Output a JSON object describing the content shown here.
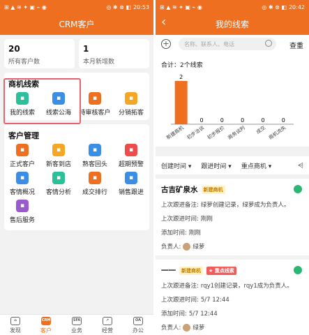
{
  "left": {
    "status": {
      "left": "⊞ ▲ ≋ ✦ ▣ ⌁ ◉",
      "right": "◎ ✱ ⊗ ◧",
      "time": "20:53"
    },
    "title": "CRM客户",
    "stats": [
      {
        "value": "20",
        "caption": "所有客户数"
      },
      {
        "value": "1",
        "caption": "本月新增数"
      }
    ],
    "leads_section": {
      "title": "商机线索",
      "items": [
        {
          "label": "我的线索",
          "icon": "leads-icon",
          "color": "#2bbf9a"
        },
        {
          "label": "线索公海",
          "icon": "pool-icon",
          "color": "#3a8ee6"
        },
        {
          "label": "待审核客户",
          "icon": "review-icon",
          "color": "#ef6f21"
        },
        {
          "label": "分销拓客",
          "icon": "distribution-icon",
          "color": "#f5a623"
        }
      ]
    },
    "customer_section": {
      "title": "客户管理",
      "items": [
        {
          "label": "正式客户",
          "icon": "customer-icon",
          "color": "#ef6f21"
        },
        {
          "label": "新客到店",
          "icon": "store-icon",
          "color": "#f5a623"
        },
        {
          "label": "熟客回头",
          "icon": "chat-icon",
          "color": "#3a8ee6"
        },
        {
          "label": "超期预警",
          "icon": "alarm-icon",
          "color": "#ef4b4b"
        },
        {
          "label": "客情概况",
          "icon": "people-icon",
          "color": "#3a8ee6"
        },
        {
          "label": "客情分析",
          "icon": "analysis-icon",
          "color": "#2bbf9a"
        },
        {
          "label": "成交排行",
          "icon": "rank-icon",
          "color": "#ef6f21"
        },
        {
          "label": "销售跟进",
          "icon": "followup-icon",
          "color": "#3a8ee6"
        },
        {
          "label": "售后服务",
          "icon": "service-icon",
          "color": "#9b59d0"
        }
      ]
    },
    "tabbar": [
      {
        "label": "发现",
        "icon": "discover-icon",
        "glyph": "⌂"
      },
      {
        "label": "客户",
        "icon": "crm-icon",
        "glyph": "CRM",
        "active": true
      },
      {
        "label": "业务",
        "icon": "sfa-icon",
        "glyph": "SFA"
      },
      {
        "label": "经营",
        "icon": "chart-icon",
        "glyph": "↗"
      },
      {
        "label": "办公",
        "icon": "oa-icon",
        "glyph": "OA"
      }
    ]
  },
  "right": {
    "status": {
      "left": "⊞ ▲ ≋ ✦ ▣ ⌁ ◉",
      "right": "◎ ✱ ⊗ ◧",
      "time": "20:42"
    },
    "title": "我的线索",
    "back": "‹",
    "search_placeholder": "名称、联系人、电话",
    "search_button": "查重",
    "summary": "合计：2个线索",
    "chart_data": {
      "type": "bar",
      "categories": [
        "新建商机",
        "初步洽谈",
        "初步报价",
        "商务谈判",
        "成交",
        "商机流失"
      ],
      "values": [
        2,
        0,
        0,
        0,
        0,
        0
      ],
      "color": "#ef6f21"
    },
    "filters": [
      "创建时间",
      "跟进时间",
      "重点商机"
    ],
    "leads": [
      {
        "name": "古吉矿泉水",
        "badges": [
          {
            "text": "新建商机",
            "kind": "new"
          }
        ],
        "rows": [
          {
            "label": "上次跟进备注:",
            "value": "绿萝创建记录，绿萝成为负责人。"
          },
          {
            "label": "上次跟进时间:",
            "value": "刚刚"
          },
          {
            "label": "添加时间:",
            "value": "刚刚"
          },
          {
            "label": "负责人:",
            "value": "绿萝",
            "avatar": true
          }
        ]
      },
      {
        "name": "一一",
        "badges": [
          {
            "text": "新建商机",
            "kind": "new"
          },
          {
            "text": "★ 重点线索",
            "kind": "key"
          }
        ],
        "rows": [
          {
            "label": "上次跟进备注:",
            "value": "rqy1创建记录，rqy1成为负责人。"
          },
          {
            "label": "上次跟进时间:",
            "value": "5/7 12:44"
          },
          {
            "label": "添加时间:",
            "value": "5/7 12:44"
          },
          {
            "label": "负责人:",
            "value": "绿萝",
            "avatar": true
          }
        ]
      }
    ]
  }
}
